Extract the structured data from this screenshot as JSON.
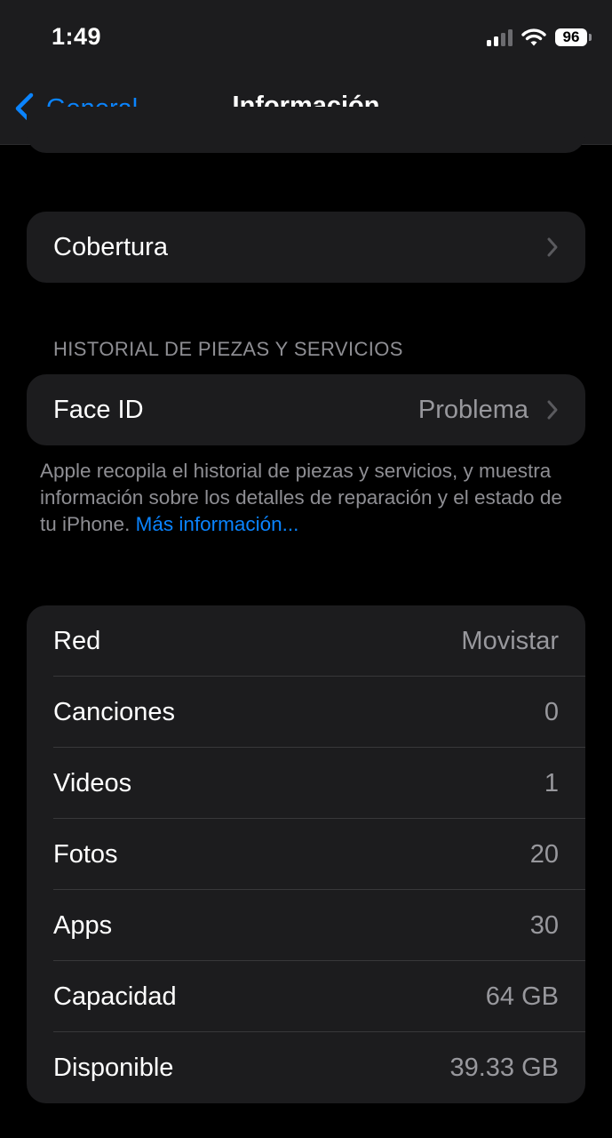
{
  "status_bar": {
    "time": "1:49",
    "battery": "96"
  },
  "nav": {
    "back_label": "General",
    "title": "Información"
  },
  "coverage": {
    "label": "Cobertura"
  },
  "parts_history": {
    "header": "HISTORIAL DE PIEZAS Y SERVICIOS",
    "face_id": {
      "label": "Face ID",
      "value": "Problema"
    },
    "footer_text": "Apple recopila el historial de piezas y servicios, y muestra información sobre los detalles de reparación y el estado de tu iPhone. ",
    "footer_link": "Más información..."
  },
  "info_rows": [
    {
      "label": "Red",
      "value": "Movistar"
    },
    {
      "label": "Canciones",
      "value": "0"
    },
    {
      "label": "Videos",
      "value": "1"
    },
    {
      "label": "Fotos",
      "value": "20"
    },
    {
      "label": "Apps",
      "value": "30"
    },
    {
      "label": "Capacidad",
      "value": "64 GB"
    },
    {
      "label": "Disponible",
      "value": "39.33 GB"
    }
  ],
  "colors": {
    "accent": "#0a84ff",
    "cell": "#1c1c1e",
    "background": "#000000",
    "secondary_text": "#98989d"
  }
}
